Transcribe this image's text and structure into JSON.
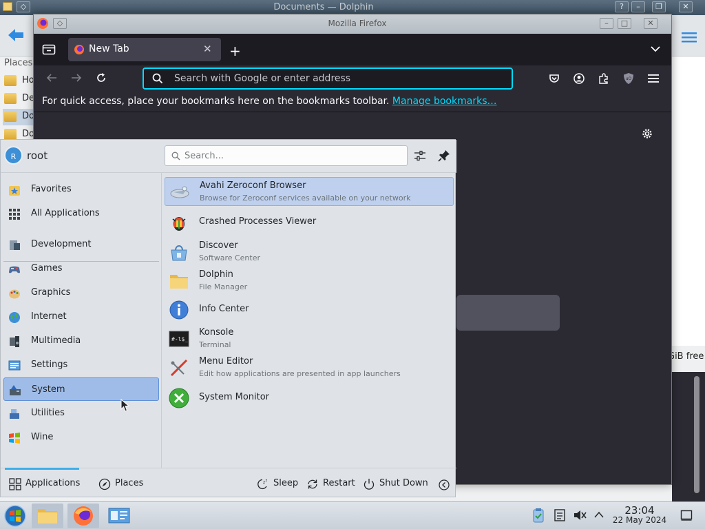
{
  "dolphin": {
    "title": "Documents — Dolphin",
    "places_label": "Places",
    "places": [
      "Home",
      "Desktop",
      "Documents",
      "Downloads"
    ],
    "free_space": "GiB free"
  },
  "firefox": {
    "window_title": "Mozilla Firefox",
    "tab_label": "New Tab",
    "url_placeholder": "Search with Google or enter address",
    "bookmarks_text": "For quick access, place your bookmarks here on the bookmarks toolbar.",
    "bookmarks_link": "Manage bookmarks…"
  },
  "launcher": {
    "user": {
      "initial": "R",
      "name": "root"
    },
    "search_placeholder": "Search...",
    "categories_top": [
      {
        "label": "Favorites",
        "icon": "favorites-icon"
      },
      {
        "label": "All Applications",
        "icon": "all-applications-icon"
      }
    ],
    "categories": [
      {
        "label": "Development",
        "icon": "development-icon"
      },
      {
        "label": "Games",
        "icon": "games-icon"
      },
      {
        "label": "Graphics",
        "icon": "graphics-icon"
      },
      {
        "label": "Internet",
        "icon": "internet-icon"
      },
      {
        "label": "Multimedia",
        "icon": "multimedia-icon"
      },
      {
        "label": "Settings",
        "icon": "settings-icon"
      },
      {
        "label": "System",
        "icon": "system-icon",
        "active": true
      },
      {
        "label": "Utilities",
        "icon": "utilities-icon"
      },
      {
        "label": "Wine",
        "icon": "wine-icon"
      }
    ],
    "apps": [
      {
        "name": "Avahi Zeroconf Browser",
        "desc": "Browse for Zeroconf services available on your network",
        "icon": "network-browser-icon",
        "active": true
      },
      {
        "name": "Crashed Processes Viewer",
        "desc": "",
        "icon": "bug-icon"
      },
      {
        "name": "Discover",
        "desc": "Software Center",
        "icon": "discover-icon"
      },
      {
        "name": "Dolphin",
        "desc": "File Manager",
        "icon": "folder-icon"
      },
      {
        "name": "Info Center",
        "desc": "",
        "icon": "info-icon"
      },
      {
        "name": "Konsole",
        "desc": "Terminal",
        "icon": "terminal-icon"
      },
      {
        "name": "Menu Editor",
        "desc": "Edit how applications are presented in app launchers",
        "icon": "menu-editor-icon"
      },
      {
        "name": "System Monitor",
        "desc": "",
        "icon": "system-monitor-icon"
      }
    ],
    "footer": {
      "applications": "Applications",
      "places": "Places",
      "sleep": "Sleep",
      "restart": "Restart",
      "shutdown": "Shut Down"
    }
  },
  "taskbar": {
    "time": "23:04",
    "date": "22 May 2024"
  },
  "colors": {
    "accent": "#3daee9",
    "selection": "#9fbce8",
    "firefox_focus": "#00ddff"
  }
}
